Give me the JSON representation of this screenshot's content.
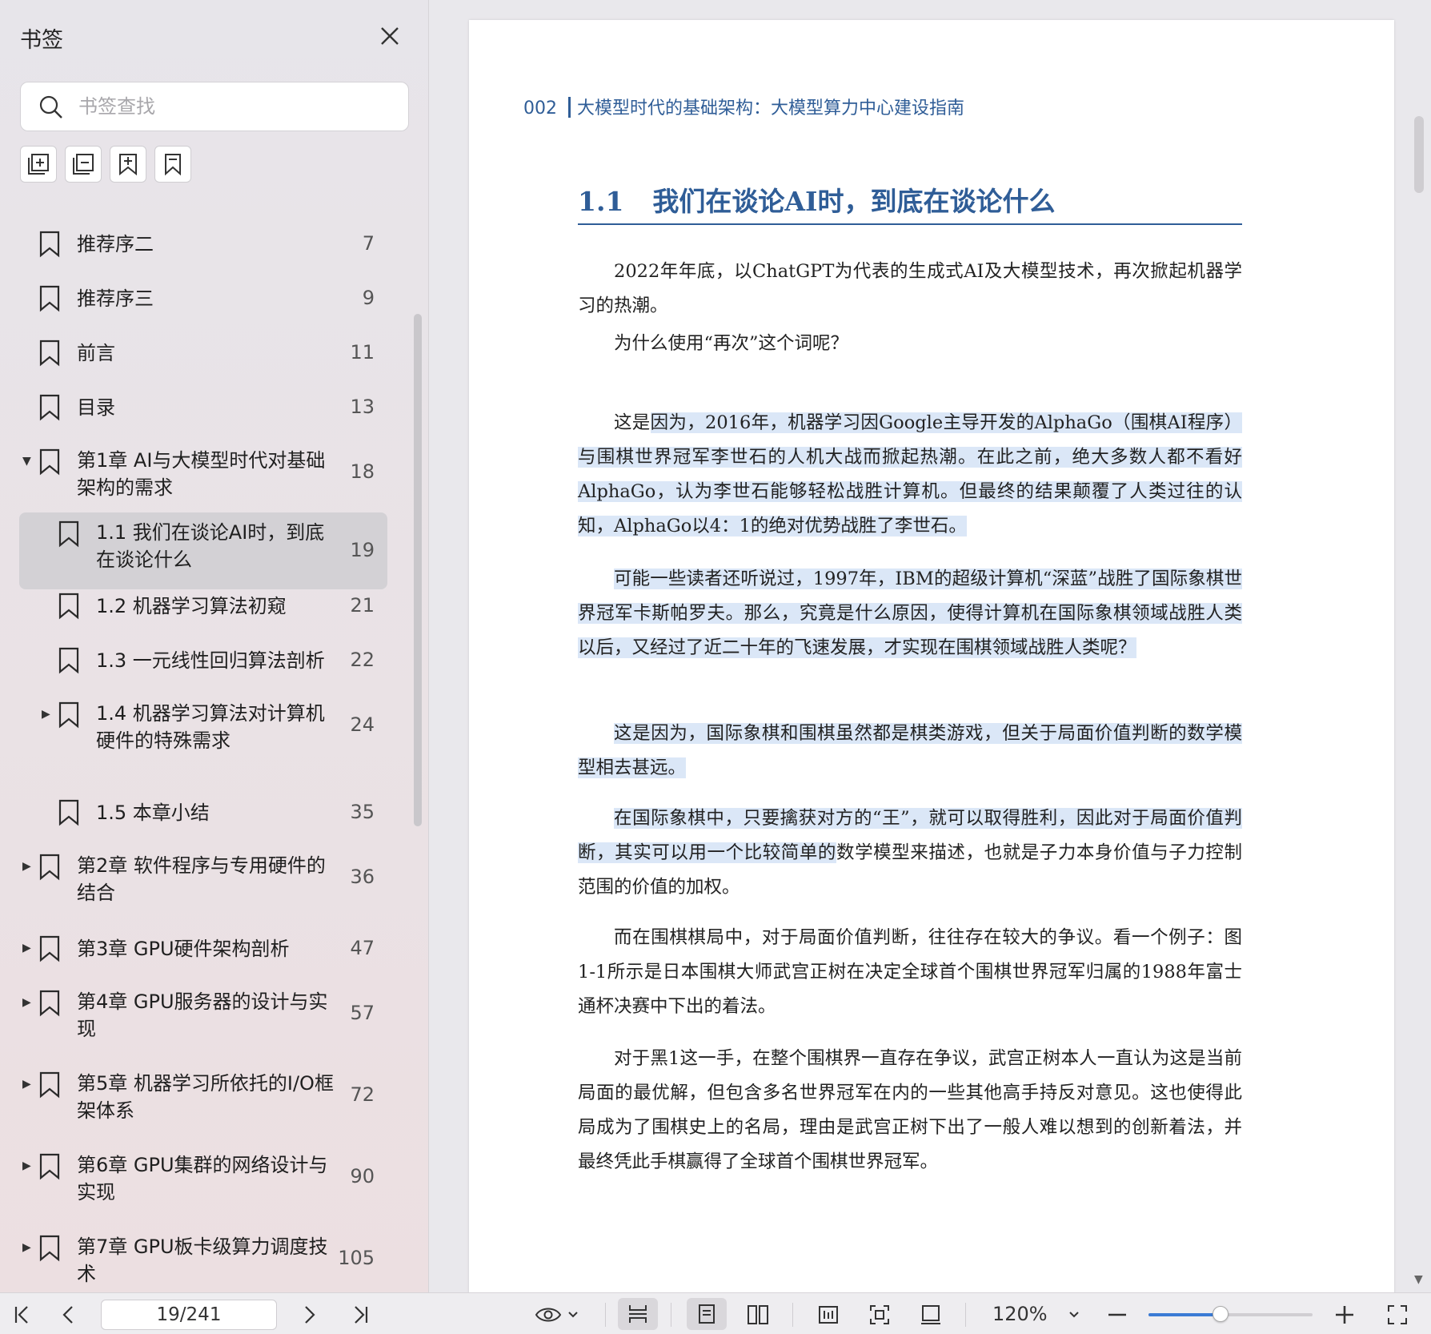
{
  "sidebar": {
    "title": "书签",
    "search_placeholder": "书签查找",
    "tools": [
      "expand-all-icon",
      "collapse-all-icon",
      "add-bookmark-icon",
      "bookmark-icon"
    ],
    "items": [
      {
        "label": "推荐序二",
        "page": "7",
        "level": 0,
        "arrow": ""
      },
      {
        "label": "推荐序三",
        "page": "9",
        "level": 0,
        "arrow": ""
      },
      {
        "label": "前言",
        "page": "11",
        "level": 0,
        "arrow": ""
      },
      {
        "label": "目录",
        "page": "13",
        "level": 0,
        "arrow": ""
      },
      {
        "label": "第1章 AI与大模型时代对基础架构的需求",
        "page": "18",
        "level": 0,
        "arrow": "▼"
      },
      {
        "label": "1.1 我们在谈论AI时，到底在谈论什么",
        "page": "19",
        "level": 1,
        "arrow": "",
        "selected": true
      },
      {
        "label": "1.2 机器学习算法初窥",
        "page": "21",
        "level": 1,
        "arrow": ""
      },
      {
        "label": "1.3 一元线性回归算法剖析",
        "page": "22",
        "level": 1,
        "arrow": ""
      },
      {
        "label": "1.4 机器学习算法对计算机硬件的特殊需求",
        "page": "24",
        "level": 1,
        "arrow": "▶"
      },
      {
        "label": "1.5 本章小结",
        "page": "35",
        "level": 1,
        "arrow": ""
      },
      {
        "label": "第2章 软件程序与专用硬件的结合",
        "page": "36",
        "level": 0,
        "arrow": "▶"
      },
      {
        "label": "第3章 GPU硬件架构剖析",
        "page": "47",
        "level": 0,
        "arrow": "▶"
      },
      {
        "label": "第4章 GPU服务器的设计与实现",
        "page": "57",
        "level": 0,
        "arrow": "▶"
      },
      {
        "label": "第5章 机器学习所依托的I/O框架体系",
        "page": "72",
        "level": 0,
        "arrow": "▶"
      },
      {
        "label": "第6章 GPU集群的网络设计与实现",
        "page": "90",
        "level": 0,
        "arrow": "▶"
      },
      {
        "label": "第7章 GPU板卡级算力调度技术",
        "page": "105",
        "level": 0,
        "arrow": "▶"
      }
    ]
  },
  "document": {
    "running_head_num": "002",
    "running_head_title": "大模型时代的基础架构：大模型算力中心建设指南",
    "section_num": "1.1",
    "section_title": "我们在谈论AI时，到底在谈论什么",
    "paragraphs": [
      {
        "pre": "2022年年底，以ChatGPT为代表的生成式AI及大模型技术，再次掀起机器学习的热潮。",
        "hl": "",
        "post": ""
      },
      {
        "pre": "为什么使用“再次”这个词呢？",
        "hl": "",
        "post": ""
      },
      {
        "pre": "这是",
        "hl": "因为，2016年，机器学习因Google主导开发的AlphaGo（围棋AI程序）与围棋世界冠军李世石的人机大战而掀起热潮。在此之前，绝大多数人都不看好AlphaGo，认为李世石能够轻松战胜计算机。但最终的结果颠覆了人类过往的认知，AlphaGo以4：1的绝对优势战胜了李世石。",
        "post": ""
      },
      {
        "pre": "",
        "hl": "可能一些读者还听说过，1997年，IBM的超级计算机“深蓝”战胜了国际象棋世界冠军卡斯帕罗夫。那么，究竟是什么原因，使得计算机在国际象棋领域战胜人类以后，又经过了近二十年的飞速发展，才实现在围棋领域战胜人类呢？",
        "post": ""
      },
      {
        "pre": "",
        "hl": "这是因为，国际象棋和围棋虽然都是棋类游戏，但关于局面价值判断的数学模型相去甚远。",
        "post": ""
      },
      {
        "pre": "",
        "hl": "在国际象棋中，只要擒获对方的“王”，就可以取得胜利，因此对于局面价值判断，其实可以用一个比较简单的",
        "post": "数学模型来描述，也就是子力本身价值与子力控制范围的价值的加权。"
      },
      {
        "pre": "而在围棋棋局中，对于局面价值判断，往往存在较大的争议。看一个例子：图1-1所示是日本围棋大师武宫正树在决定全球首个围棋世界冠军归属的1988年富士通杯决赛中下出的着法。",
        "hl": "",
        "post": ""
      },
      {
        "pre": "对于黑1这一手，在整个围棋界一直存在争议，武宫正树本人一直认为这是当前局面的最优解，但包含多名世界冠军在内的一些其他高手持反对意见。这也使得此局成为了围棋史上的名局，理由是武宫正树下出了一般人难以想到的创新着法，并最终凭此手棋赢得了全球首个围棋世界冠军。",
        "hl": "",
        "post": ""
      }
    ]
  },
  "toolbar": {
    "page_indicator": "19/241",
    "zoom": "120%",
    "zoom_slider_fraction": 0.44,
    "accent_color": "#3a7bd5"
  }
}
